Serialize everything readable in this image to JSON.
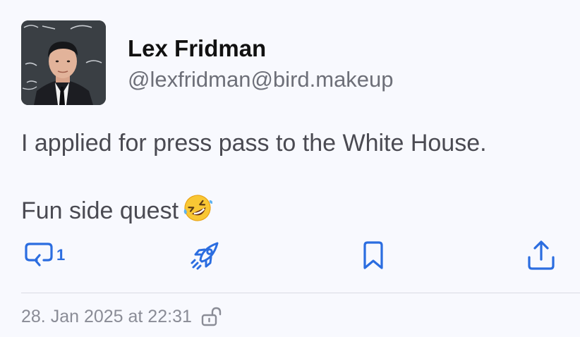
{
  "author": {
    "display_name": "Lex Fridman",
    "handle": "@lexfridman@bird.makeup",
    "avatar_icon": "profile-photo"
  },
  "post": {
    "lines": [
      "I applied for press pass to the White House.",
      "Fun side quest"
    ],
    "emoji_icon": "rolling-on-floor-laughing-emoji"
  },
  "actions": {
    "reply_count": "1",
    "reply_icon": "reply-icon",
    "boost_icon": "rocket-icon",
    "bookmark_icon": "bookmark-icon",
    "share_icon": "share-icon"
  },
  "meta": {
    "timestamp": "28. Jan 2025 at 22:31",
    "visibility_icon": "unlock-icon"
  },
  "colors": {
    "accent": "#2b6de0",
    "background": "#f8f9fe",
    "secondary_text": "#6d6f78"
  }
}
